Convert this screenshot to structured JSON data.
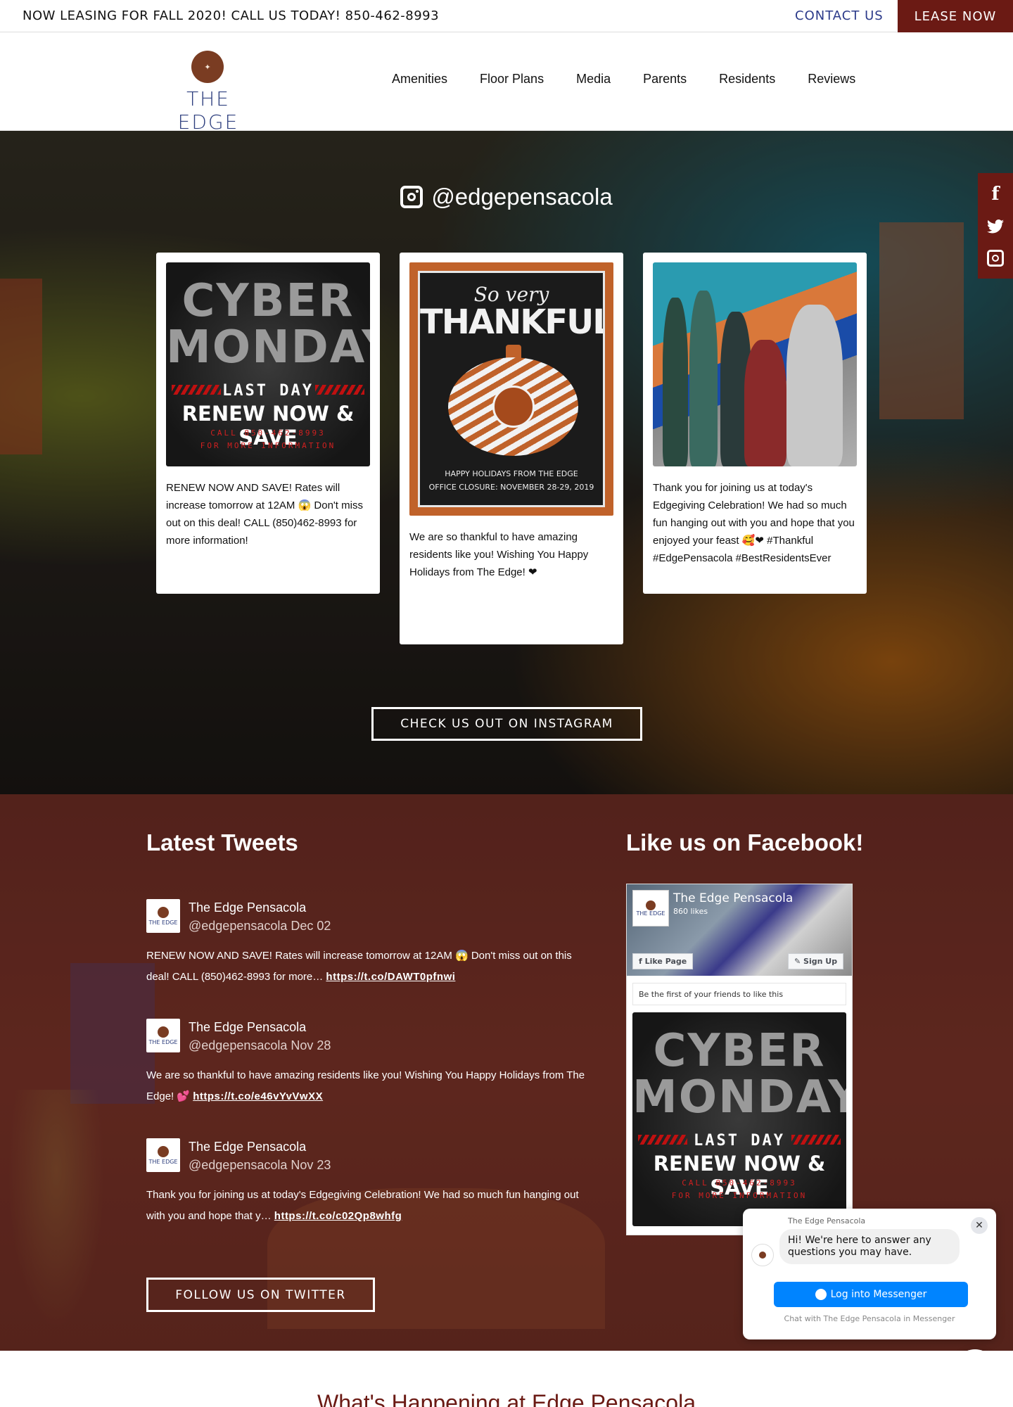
{
  "topbar": {
    "announcement": "NOW LEASING FOR FALL 2020! CALL US TODAY! 850-462-8993",
    "contact_label": "CONTACT US",
    "lease_label": "LEASE NOW"
  },
  "logo": {
    "brand": "THE EDGE"
  },
  "nav": {
    "items": [
      {
        "label": "Amenities"
      },
      {
        "label": "Floor Plans"
      },
      {
        "label": "Media",
        "active": true
      },
      {
        "label": "Parents"
      },
      {
        "label": "Residents"
      },
      {
        "label": "Reviews"
      }
    ]
  },
  "instagram": {
    "handle": "@edgepensacola",
    "posts": [
      {
        "image": "cyber-monday-graphic",
        "text": "RENEW NOW AND SAVE! Rates will increase tomorrow at 12AM 😱 Don't miss out on this deal! CALL (850)462-8993 for more information!"
      },
      {
        "image": "so-very-thankful-graphic",
        "text": "We are so thankful to have amazing residents like you! Wishing You Happy Holidays from The Edge! ❤"
      },
      {
        "image": "edgegiving-celebration-photo",
        "text": "Thank you for joining us at today's Edgegiving Celebration! We had so much fun hanging out with you and hope that you enjoyed your feast 🥰❤ #Thankful #EdgePensacola #BestResidentsEver"
      }
    ],
    "cta": "CHECK US OUT ON INSTAGRAM"
  },
  "cyber_graphic": {
    "line1": "CYBER",
    "line2": "MONDAY",
    "last_day": "LAST DAY",
    "renew": "RENEW NOW & SAVE",
    "call": "CALL 850-462-8993",
    "more": "FOR MORE INFORMATION"
  },
  "thankful_graphic": {
    "so_very": "So very",
    "thankful": "THANKFUL",
    "holiday_line1": "HAPPY HOLIDAYS FROM THE EDGE",
    "holiday_line2": "OFFICE CLOSURE: NOVEMBER 28-29, 2019"
  },
  "side_social": [
    "facebook-icon",
    "twitter-icon",
    "instagram-icon"
  ],
  "tweets": {
    "title": "Latest Tweets",
    "items": [
      {
        "name": "The Edge Pensacola",
        "meta": "@edgepensacola Dec 02",
        "text": "RENEW NOW AND SAVE! Rates will increase tomorrow at 12AM 😱 Don't miss out on this deal! CALL (850)462-8993 for more… ",
        "link": "https://t.co/DAWT0pfnwi"
      },
      {
        "name": "The Edge Pensacola",
        "meta": "@edgepensacola Nov 28",
        "text": "We are so thankful to have amazing residents like you! Wishing You Happy Holidays from The Edge! 💕 ",
        "link": "https://t.co/e46vYvVwXX"
      },
      {
        "name": "The Edge Pensacola",
        "meta": "@edgepensacola Nov 23",
        "text": "Thank you for joining us at today's Edgegiving Celebration! We had so much fun hanging out with you and hope that y… ",
        "link": "https://t.co/c02Qp8whfg"
      }
    ],
    "avatar_label": "THE EDGE",
    "cta": "FOLLOW US ON TWITTER"
  },
  "facebook": {
    "title": "Like us on Facebook!",
    "page_name": "The Edge Pensacola",
    "likes": "860 likes",
    "like_btn": "Like Page",
    "signup_btn": "Sign Up",
    "friends_text": "Be the first of your friends to like this"
  },
  "messenger": {
    "page_name": "The Edge Pensacola",
    "greeting": "Hi! We're here to answer any questions you may have.",
    "login": "Log into Messenger",
    "chat_with": "Chat with The Edge Pensacola in Messenger"
  },
  "happening": {
    "title": "What's Happening at Edge Pensacola"
  },
  "colors": {
    "brand_red": "#6b1a14",
    "brand_blue": "#2e3f7e",
    "nav_active": "#2431b8",
    "messenger_blue": "#0084ff"
  }
}
